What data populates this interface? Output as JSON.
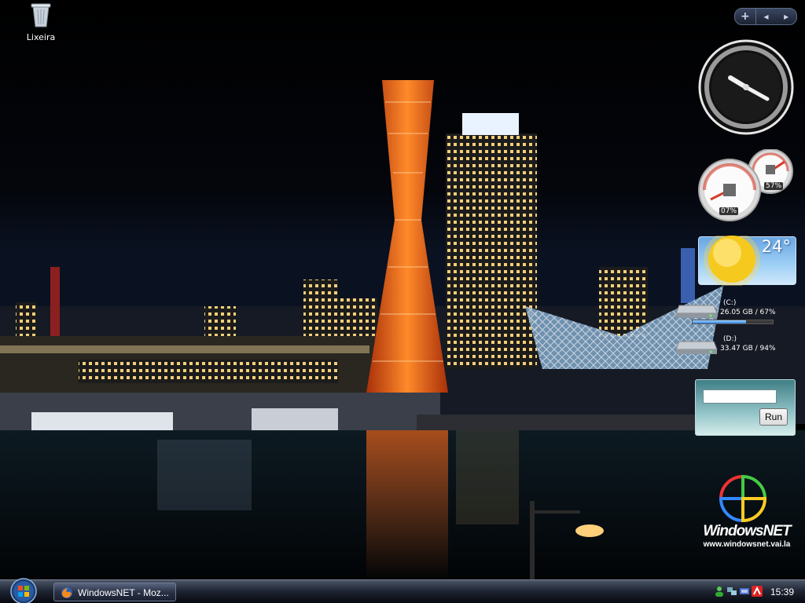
{
  "desktop": {
    "icons": [
      {
        "label": "Lixeira",
        "icon": "recycle-bin-icon"
      }
    ]
  },
  "sidebar": {
    "controls": {
      "add": "+",
      "prev": "◂",
      "next": "▸"
    },
    "cpu_gauge": {
      "cpu_percent": "07%",
      "memory_percent": "57%"
    },
    "weather": {
      "temperature": "24°",
      "condition_icon": "sun-icon"
    },
    "drives": [
      {
        "label": "(C:)",
        "stats": "26.05 GB / 67%",
        "usage": 0.67
      },
      {
        "label": "(D:)",
        "stats": "33.47 GB / 94%",
        "usage": 0.94
      }
    ],
    "run": {
      "input_value": "",
      "button_label": "Run"
    }
  },
  "branding": {
    "name": "WindowsNET",
    "url": "www.windowsnet.vai.la"
  },
  "taskbar": {
    "start_icon": "windows-orb-icon",
    "tasks": [
      {
        "label": "WindowsNET - Moz...",
        "icon": "firefox-icon"
      }
    ],
    "tray_icons": [
      "network-users-icon",
      "network-icon",
      "connection-icon",
      "antivirus-icon"
    ],
    "time": "15:39"
  },
  "colors": {
    "tower": "#e8621a",
    "sky": "#000000",
    "taskbar": "#1f2533",
    "gauge_red": "#d63a2a"
  }
}
